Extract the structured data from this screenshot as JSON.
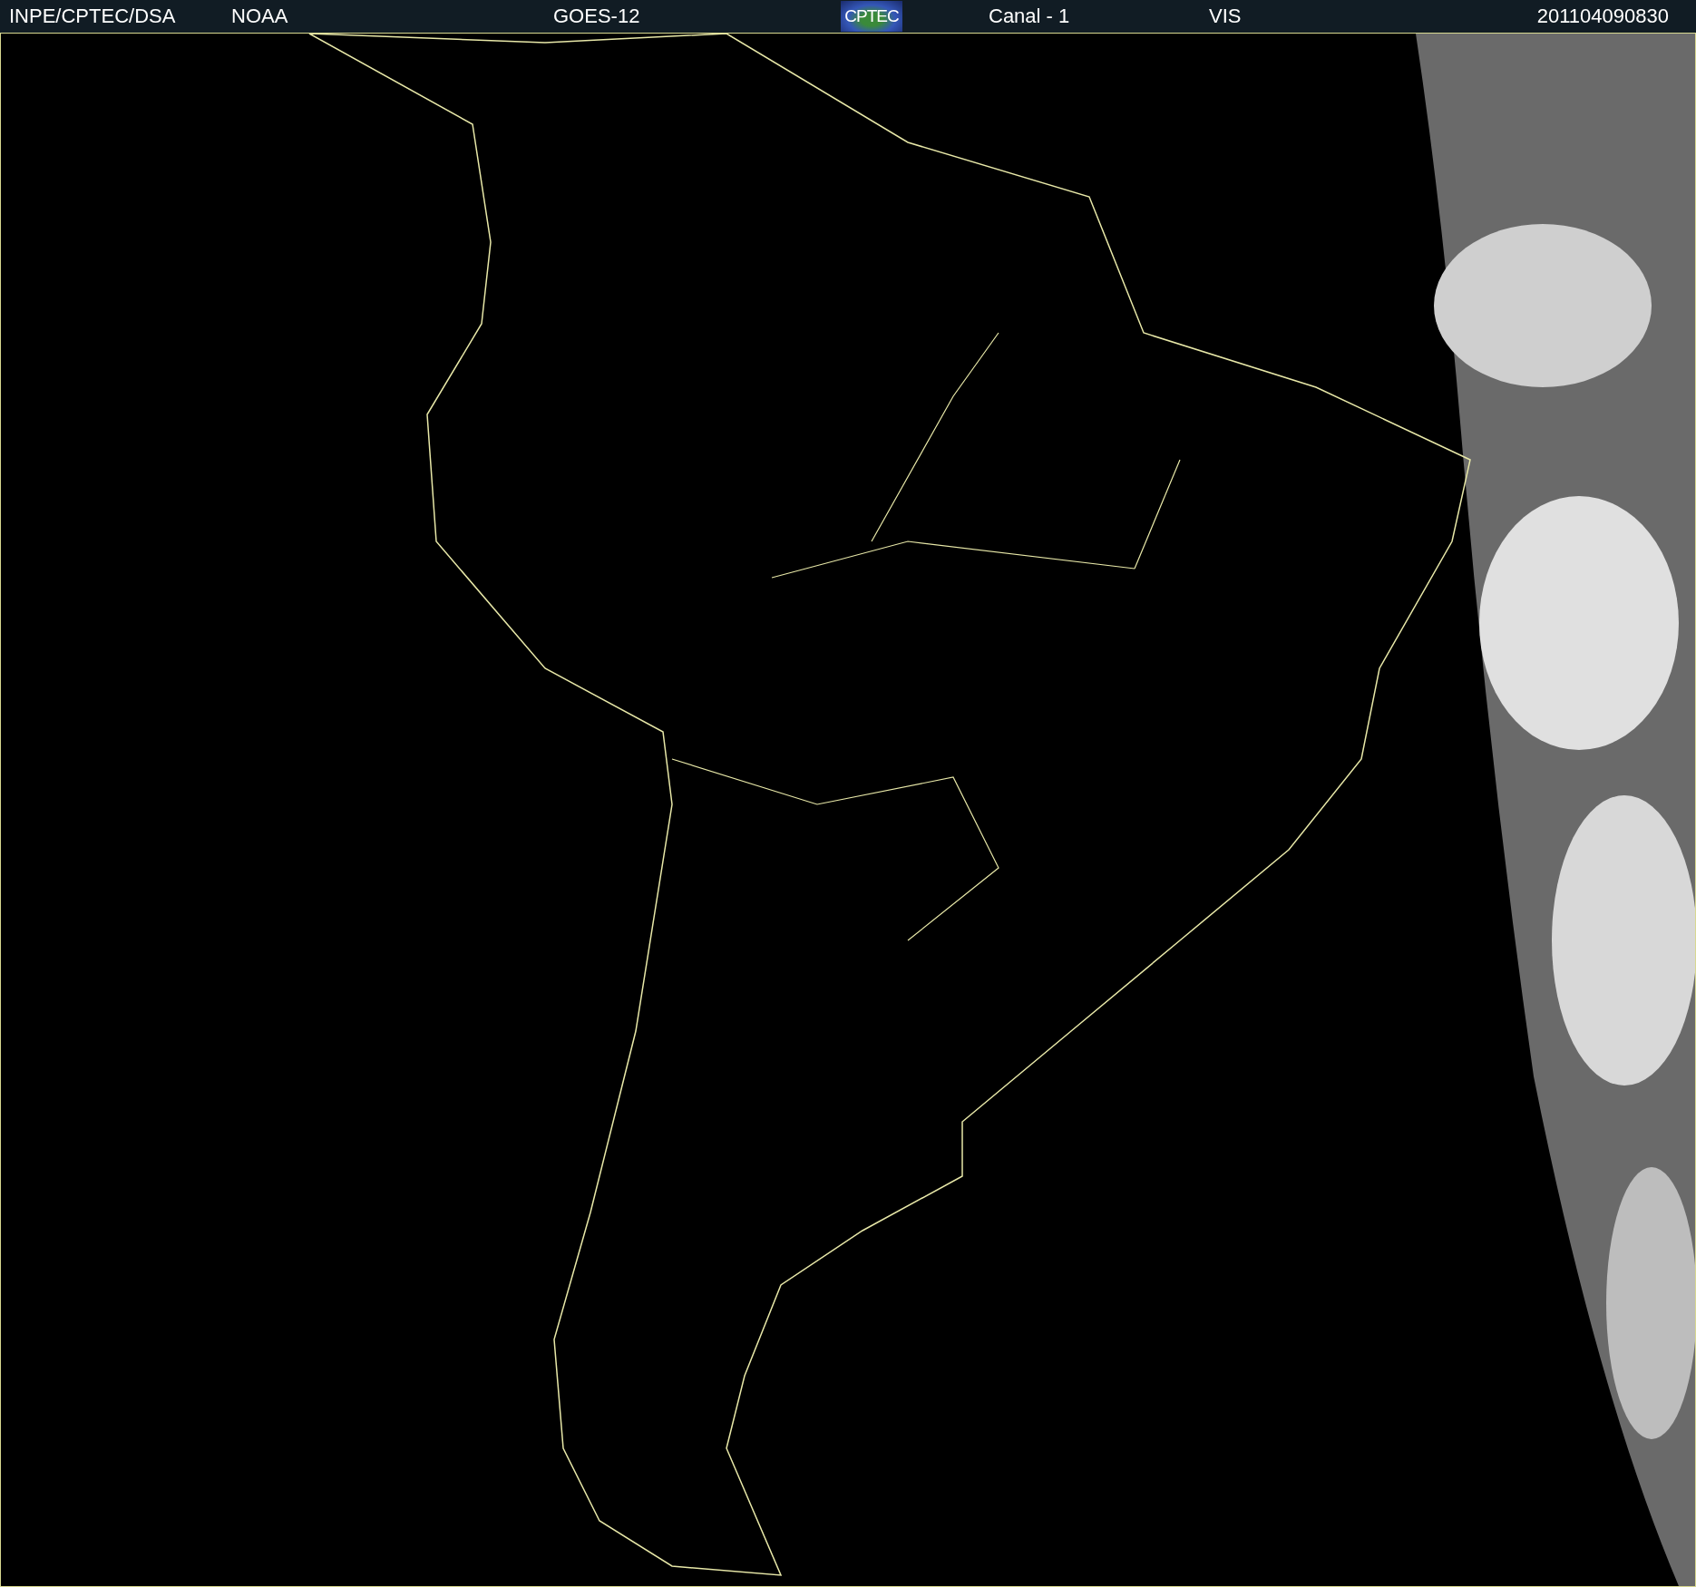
{
  "header": {
    "source": "INPE/CPTEC/DSA",
    "agency": "NOAA",
    "satellite": "GOES-12",
    "logo_text": "CPTEC",
    "channel": "Canal - 1",
    "band": "VIS",
    "timestamp": "201104090830"
  }
}
